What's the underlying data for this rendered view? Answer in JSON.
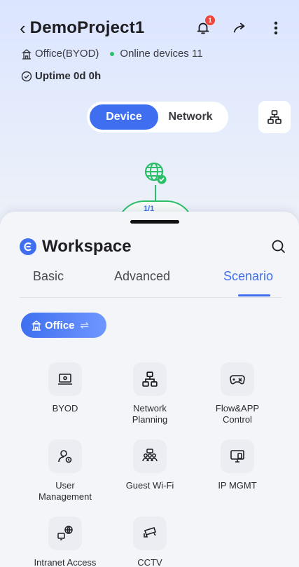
{
  "header": {
    "back_icon": "chevron-left-icon",
    "title": "DemoProject1",
    "notification_badge": "1",
    "site_type": "Office(BYOD)",
    "online_devices": "Online devices 11",
    "uptime": "Uptime 0d 0h"
  },
  "view_switch": {
    "device_label": "Device",
    "network_label": "Network",
    "selected": "Device"
  },
  "topology": {
    "count": "1/1"
  },
  "workspace": {
    "title": "Workspace",
    "tabs": [
      {
        "label": "Basic"
      },
      {
        "label": "Advanced"
      },
      {
        "label": "Scenario"
      }
    ],
    "active_tab": "Scenario",
    "scenario_chip": "Office",
    "tiles": [
      {
        "label": "BYOD",
        "icon": "laptop-icon"
      },
      {
        "label": "Network Planning",
        "icon": "topology-icon"
      },
      {
        "label": "Flow&APP Control",
        "icon": "gamepad-icon"
      },
      {
        "label": "User Management",
        "icon": "user-settings-icon"
      },
      {
        "label": "Guest Wi-Fi",
        "icon": "guest-group-icon"
      },
      {
        "label": "IP MGMT",
        "icon": "monitor-icon"
      },
      {
        "label": "Intranet Access",
        "icon": "intranet-globe-icon"
      },
      {
        "label": "CCTV",
        "icon": "camera-icon"
      }
    ]
  },
  "colors": {
    "accent": "#3f6ff0",
    "online": "#2bbf6a",
    "badge": "#f0453a"
  }
}
